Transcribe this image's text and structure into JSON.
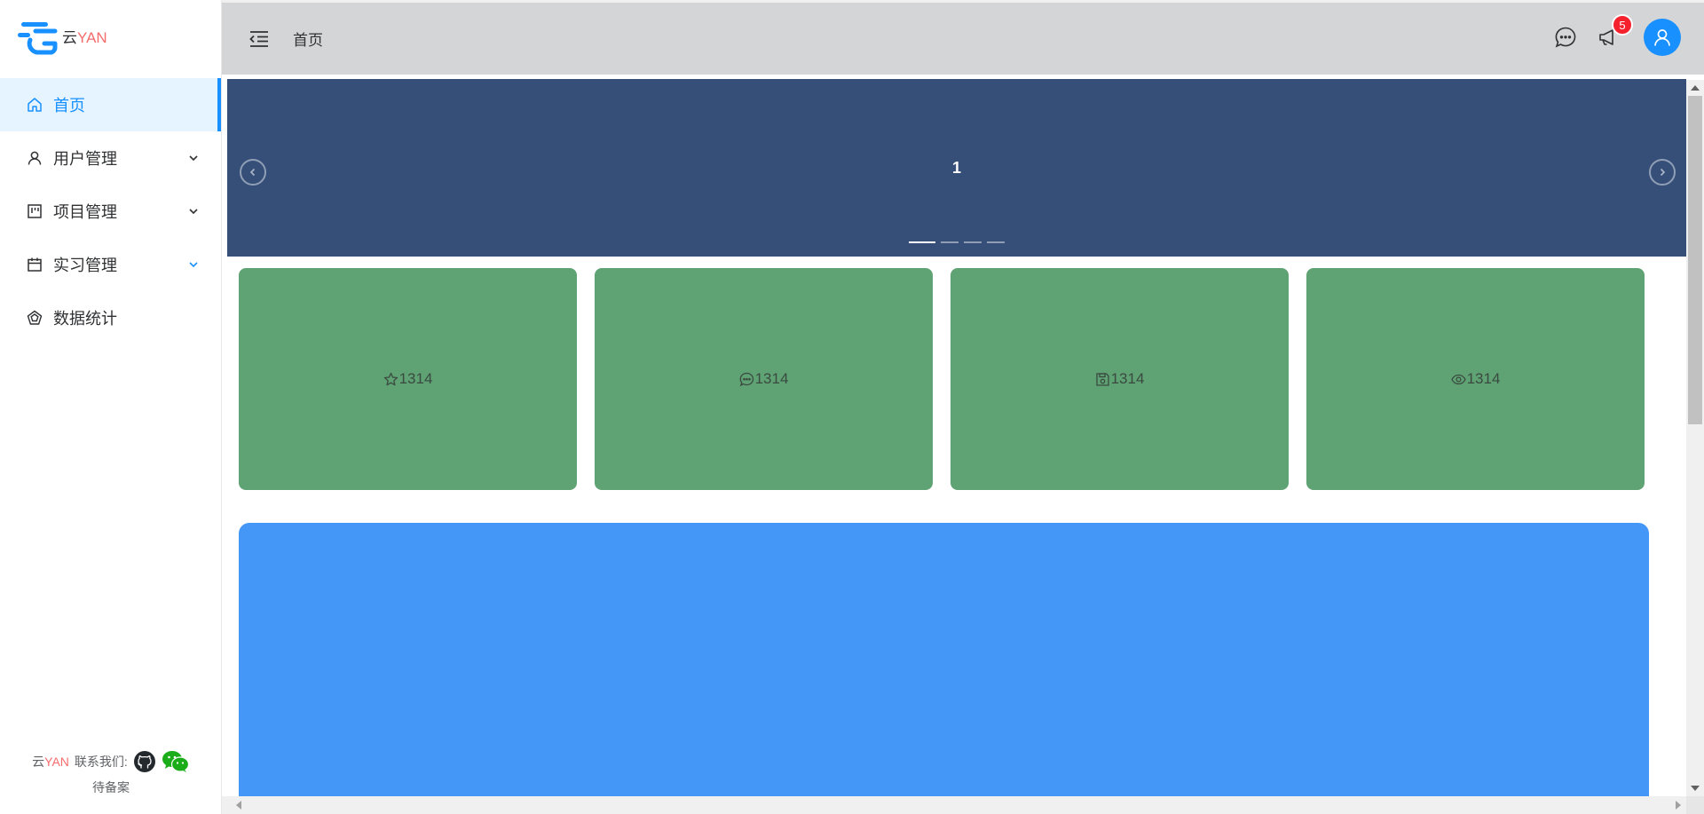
{
  "brand": {
    "yun": "云",
    "yan": "YAN"
  },
  "sidebar": {
    "items": [
      {
        "label": "首页",
        "icon": "home-icon",
        "active": true,
        "expandable": false
      },
      {
        "label": "用户管理",
        "icon": "user-icon",
        "active": false,
        "expandable": true
      },
      {
        "label": "项目管理",
        "icon": "project-icon",
        "active": false,
        "expandable": true
      },
      {
        "label": "实习管理",
        "icon": "calendar-icon",
        "active": false,
        "expandable": true
      },
      {
        "label": "数据统计",
        "icon": "data-icon",
        "active": false,
        "expandable": false
      }
    ],
    "footer": {
      "yun": "云",
      "yan": "YAN",
      "contact": "联系我们:",
      "beian": "待备案"
    }
  },
  "header": {
    "breadcrumb": "首页",
    "notification_count": "5"
  },
  "carousel": {
    "current": "1",
    "slide_count": 4,
    "active_index": 0
  },
  "stats": [
    {
      "icon": "star-icon",
      "value": "1314"
    },
    {
      "icon": "message-icon",
      "value": "1314"
    },
    {
      "icon": "save-icon",
      "value": "1314"
    },
    {
      "icon": "eye-icon",
      "value": "1314"
    }
  ],
  "colors": {
    "accent": "#1890ff",
    "carousel_bg": "#364f79",
    "stat_card_bg": "#5fa374",
    "panel_bg": "#4496f7",
    "brand_red": "#f56c6c",
    "badge_red": "#f5222d"
  }
}
